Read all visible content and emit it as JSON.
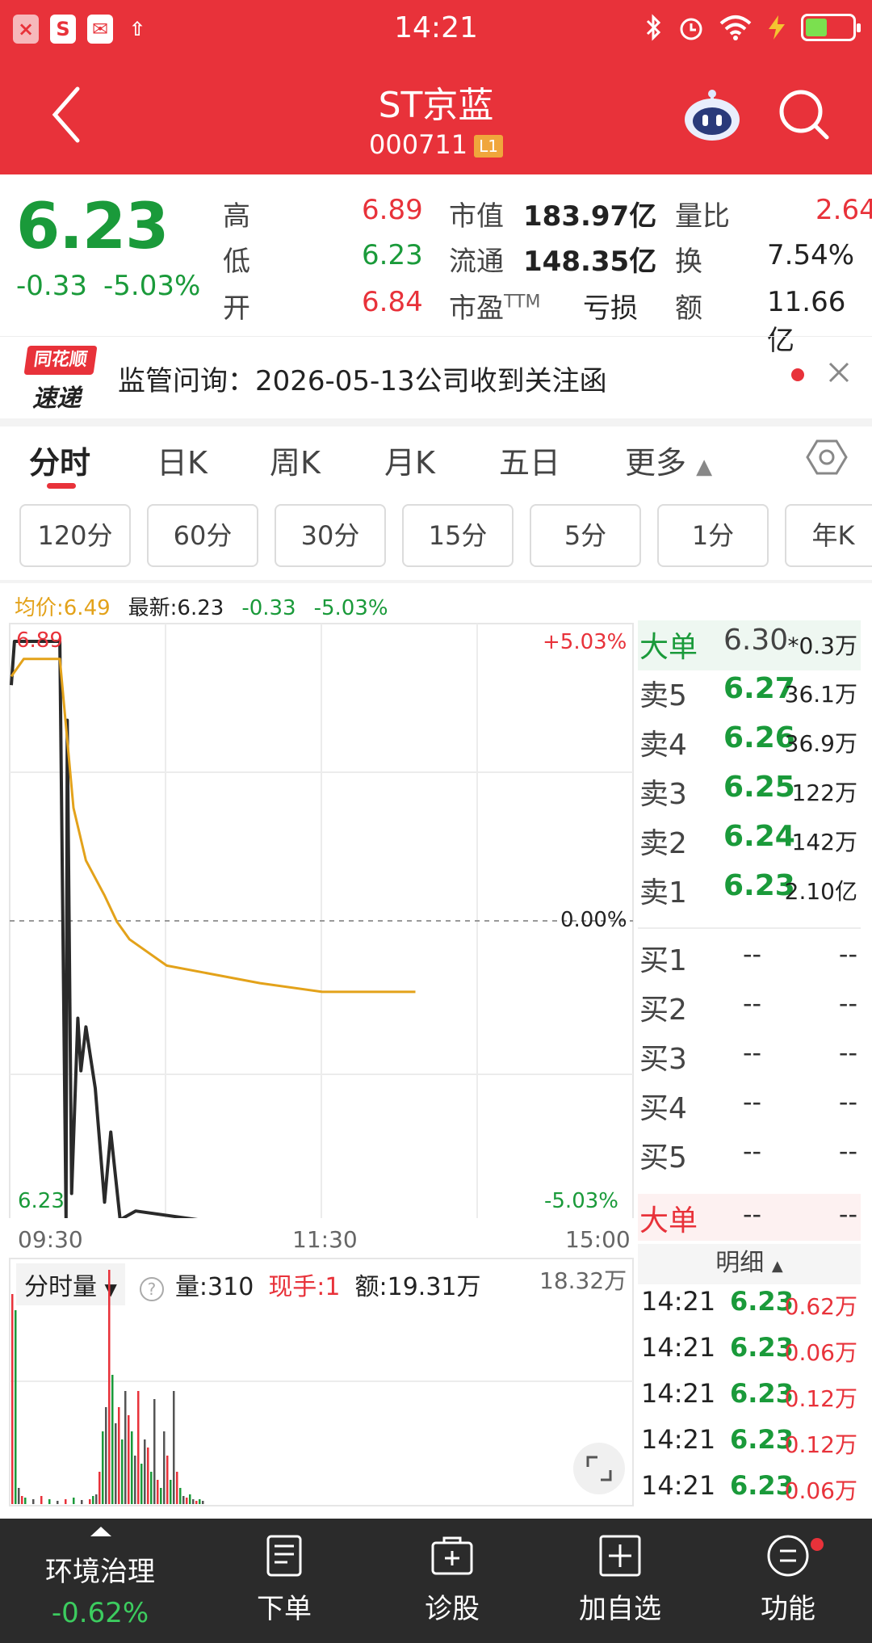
{
  "status": {
    "time": "14:21"
  },
  "header": {
    "title": "ST京蓝",
    "code": "000711",
    "level_badge": "L1"
  },
  "quote": {
    "price": "6.23",
    "change": "-0.33",
    "change_pct": "-5.03%",
    "high_label": "高",
    "high": "6.89",
    "low_label": "低",
    "low": "6.23",
    "open_label": "开",
    "open": "6.84",
    "mktcap_label": "市值",
    "mktcap": "183.97亿",
    "float_label": "流通",
    "float": "148.35亿",
    "pe_label": "市盈",
    "pe_suffix": "TTM",
    "pe": "亏损",
    "volratio_label": "量比",
    "volratio": "2.64",
    "turnover_label": "换",
    "turnover": "7.54%",
    "amount_label": "额",
    "amount": "11.66亿"
  },
  "news": {
    "logo_top": "同花顺",
    "logo_bottom": "速递",
    "text": "监管问询：2026-05-13公司收到关注函"
  },
  "period_tabs": [
    "分时",
    "日K",
    "周K",
    "月K",
    "五日",
    "更多"
  ],
  "interval_chips": [
    "120分",
    "60分",
    "30分",
    "15分",
    "5分",
    "1分",
    "年K"
  ],
  "chart_legend": {
    "avg": "均价:6.49",
    "latest": "最新:6.23",
    "chg": "-0.33",
    "pct": "-5.03%"
  },
  "chart_axis": {
    "top_price": "6.89",
    "bottom_price": "6.23",
    "top_pct": "+5.03%",
    "mid_pct": "0.00%",
    "bottom_pct": "-5.03%",
    "t_start": "09:30",
    "t_mid": "11:30",
    "t_end": "15:00"
  },
  "chart_data": {
    "type": "line",
    "x": [
      "09:30",
      "11:30",
      "15:00"
    ],
    "ylim": [
      6.23,
      6.89
    ],
    "series": [
      {
        "name": "最新",
        "color": "#2a2a2a",
        "values": [
          6.84,
          6.89,
          6.89,
          6.23,
          6.8,
          6.26,
          6.46,
          6.4,
          6.45,
          6.38,
          6.25,
          6.33,
          6.23,
          6.24,
          6.23,
          6.23
        ]
      },
      {
        "name": "均价",
        "color": "#e3a21a",
        "values": [
          6.85,
          6.87,
          6.87,
          6.7,
          6.64,
          6.6,
          6.57,
          6.55,
          6.52,
          6.5,
          6.49,
          6.49,
          6.49
        ]
      }
    ],
    "grid": true
  },
  "order_book": {
    "big_label": "大单",
    "big_price": "6.30",
    "big_vol": "*0.3万",
    "asks": [
      {
        "label": "卖5",
        "price": "6.27",
        "vol": "36.1万"
      },
      {
        "label": "卖4",
        "price": "6.26",
        "vol": "36.9万"
      },
      {
        "label": "卖3",
        "price": "6.25",
        "vol": "122万"
      },
      {
        "label": "卖2",
        "price": "6.24",
        "vol": "142万"
      },
      {
        "label": "卖1",
        "price": "6.23",
        "vol": "2.10亿"
      }
    ],
    "bids": [
      {
        "label": "买1",
        "price": "--",
        "vol": "--"
      },
      {
        "label": "买2",
        "price": "--",
        "vol": "--"
      },
      {
        "label": "买3",
        "price": "--",
        "vol": "--"
      },
      {
        "label": "买4",
        "price": "--",
        "vol": "--"
      },
      {
        "label": "买5",
        "price": "--",
        "vol": "--"
      }
    ],
    "big2_label": "大单",
    "big2_price": "--",
    "big2_vol": "--"
  },
  "ticks": {
    "header": "明细",
    "rows": [
      {
        "time": "14:21",
        "price": "6.23",
        "vol": "0.62万"
      },
      {
        "time": "14:21",
        "price": "6.23",
        "vol": "0.06万"
      },
      {
        "time": "14:21",
        "price": "6.23",
        "vol": "0.12万"
      },
      {
        "time": "14:21",
        "price": "6.23",
        "vol": "0.12万"
      },
      {
        "time": "14:21",
        "price": "6.23",
        "vol": "0.06万"
      }
    ]
  },
  "volume": {
    "selector": "分时量",
    "qty": "量:310",
    "hand": "现手:1",
    "amount": "额:19.31万",
    "max": "18.32万"
  },
  "bottom_bar": {
    "sector_name": "环境治理",
    "sector_chg": "-0.62%",
    "items": [
      "下单",
      "诊股",
      "加自选",
      "功能"
    ]
  },
  "colors": {
    "red": "#e8323a",
    "green": "#1a9a3a",
    "avg_line": "#e3a21a"
  }
}
